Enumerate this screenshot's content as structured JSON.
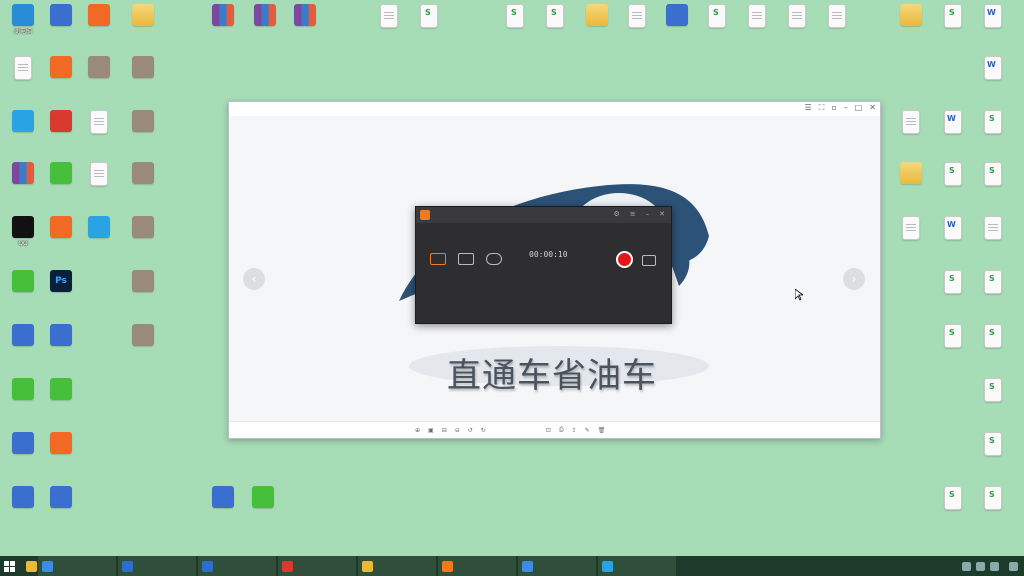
{
  "colors": {
    "desktop_bg": "#a6dcb6",
    "taskbar_bg": "#1e3a2a",
    "accent_orange": "#f07a1c",
    "record_red": "#e6141b"
  },
  "desktop": {
    "col1": [
      {
        "label": "此电脑",
        "icon": "monitor-icon",
        "kind": "monitor"
      },
      {
        "label": "",
        "icon": "document-icon",
        "kind": "doc"
      },
      {
        "label": "",
        "icon": "app-icon",
        "kind": "blue"
      },
      {
        "label": "",
        "icon": "winrar-icon",
        "kind": "winrar"
      },
      {
        "label": "QQ",
        "icon": "qq-penguin-icon",
        "kind": "penguin"
      },
      {
        "label": "",
        "icon": "app-icon",
        "kind": "green"
      },
      {
        "label": "",
        "icon": "app-icon",
        "kind": "app"
      },
      {
        "label": "",
        "icon": "app-icon",
        "kind": "green"
      },
      {
        "label": "",
        "icon": "app-icon",
        "kind": "app"
      },
      {
        "label": "",
        "icon": "network-icon",
        "kind": "app"
      }
    ],
    "col2": [
      {
        "label": "",
        "icon": "app-icon",
        "kind": "app"
      },
      {
        "label": "",
        "icon": "app-icon",
        "kind": "orange"
      },
      {
        "label": "",
        "icon": "app-icon",
        "kind": "red"
      },
      {
        "label": "",
        "icon": "app-icon",
        "kind": "green"
      },
      {
        "label": "",
        "icon": "app-icon",
        "kind": "orange"
      },
      {
        "label": "",
        "icon": "photoshop-icon",
        "kind": "ps",
        "glyph": "Ps"
      },
      {
        "label": "",
        "icon": "app-icon",
        "kind": "app"
      },
      {
        "label": "",
        "icon": "app-icon",
        "kind": "green"
      },
      {
        "label": "",
        "icon": "app-icon",
        "kind": "orange"
      },
      {
        "label": "",
        "icon": "network-icon",
        "kind": "app"
      }
    ],
    "col3": [
      {
        "label": "",
        "icon": "app-icon",
        "kind": "orange"
      },
      {
        "label": "",
        "icon": "exe-icon",
        "kind": "exe"
      },
      {
        "label": "",
        "icon": "document-icon",
        "kind": "doc"
      },
      {
        "label": "",
        "icon": "document-icon",
        "kind": "doc"
      },
      {
        "label": "",
        "icon": "app-icon",
        "kind": "blue"
      }
    ],
    "col4": [
      {
        "label": "",
        "icon": "folder-icon",
        "kind": "folder"
      },
      {
        "label": "",
        "icon": "exe-icon",
        "kind": "exe"
      },
      {
        "label": "",
        "icon": "exe-icon",
        "kind": "exe"
      },
      {
        "label": "",
        "icon": "exe-icon",
        "kind": "exe"
      },
      {
        "label": "",
        "icon": "exe-icon",
        "kind": "exe"
      },
      {
        "label": "",
        "icon": "exe-icon",
        "kind": "exe"
      },
      {
        "label": "",
        "icon": "exe-icon",
        "kind": "exe"
      }
    ],
    "top_row": [
      {
        "label": "",
        "icon": "winrar-icon",
        "kind": "winrar"
      },
      {
        "label": "",
        "icon": "winrar-icon",
        "kind": "winrar"
      },
      {
        "label": "",
        "icon": "winrar-icon",
        "kind": "winrar"
      },
      {
        "label": "",
        "icon": "document-icon",
        "kind": "doc"
      },
      {
        "label": "",
        "icon": "spreadsheet-icon",
        "kind": "xls"
      },
      {
        "label": "",
        "icon": "spreadsheet-icon",
        "kind": "xls"
      },
      {
        "label": "",
        "icon": "spreadsheet-icon",
        "kind": "xls"
      },
      {
        "label": "",
        "icon": "folder-icon",
        "kind": "folder"
      },
      {
        "label": "",
        "icon": "document-icon",
        "kind": "doc"
      },
      {
        "label": "",
        "icon": "app-icon",
        "kind": "app"
      },
      {
        "label": "",
        "icon": "spreadsheet-icon",
        "kind": "xls"
      },
      {
        "label": "",
        "icon": "document-icon",
        "kind": "doc"
      },
      {
        "label": "",
        "icon": "document-icon",
        "kind": "doc"
      },
      {
        "label": "",
        "icon": "document-icon",
        "kind": "doc"
      }
    ],
    "right_cols": [
      {
        "label": "",
        "icon": "folder-icon",
        "kind": "folder"
      },
      {
        "label": "",
        "icon": "spreadsheet-icon",
        "kind": "xls"
      },
      {
        "label": "",
        "icon": "word-icon",
        "kind": "word"
      },
      {
        "label": "",
        "icon": "word-icon",
        "kind": "word"
      },
      {
        "label": "",
        "icon": "document-icon",
        "kind": "doc"
      },
      {
        "label": "",
        "icon": "word-icon",
        "kind": "word"
      },
      {
        "label": "",
        "icon": "spreadsheet-icon",
        "kind": "xls"
      },
      {
        "label": "",
        "icon": "folder-icon",
        "kind": "folder"
      },
      {
        "label": "",
        "icon": "spreadsheet-icon",
        "kind": "xls"
      },
      {
        "label": "",
        "icon": "spreadsheet-icon",
        "kind": "xls"
      },
      {
        "label": "",
        "icon": "document-icon",
        "kind": "doc"
      },
      {
        "label": "",
        "icon": "word-icon",
        "kind": "word"
      },
      {
        "label": "",
        "icon": "document-icon",
        "kind": "doc"
      },
      {
        "label": "",
        "icon": "spreadsheet-icon",
        "kind": "xls"
      },
      {
        "label": "",
        "icon": "spreadsheet-icon",
        "kind": "xls"
      },
      {
        "label": "",
        "icon": "spreadsheet-icon",
        "kind": "xls"
      },
      {
        "label": "",
        "icon": "spreadsheet-icon",
        "kind": "xls"
      },
      {
        "label": "",
        "icon": "spreadsheet-icon",
        "kind": "xls"
      },
      {
        "label": "",
        "icon": "spreadsheet-icon",
        "kind": "xls"
      },
      {
        "label": "",
        "icon": "spreadsheet-icon",
        "kind": "xls"
      },
      {
        "label": "",
        "icon": "spreadsheet-icon",
        "kind": "xls"
      }
    ],
    "bottom_icons": [
      {
        "label": "",
        "icon": "app-icon",
        "kind": "app"
      },
      {
        "label": "",
        "icon": "app-icon",
        "kind": "green"
      }
    ]
  },
  "viewer": {
    "title": "",
    "version": "",
    "caption": "直通车省油车",
    "bottom_left": "",
    "bottom_right": "",
    "prev_arrow": "‹",
    "next_arrow": "›"
  },
  "recorder": {
    "app_name": "",
    "timer": "00:00:10",
    "settings_label": "",
    "audio_label": "",
    "record_button": "",
    "left_link": "",
    "right_link": ""
  },
  "taskbar": {
    "tasks": [
      {
        "label": "",
        "icon": "browser-icon",
        "color": "#3a8de0"
      },
      {
        "label": "",
        "icon": "app-icon",
        "color": "#2a6fc9"
      },
      {
        "label": "",
        "icon": "app-icon",
        "color": "#2a6fc9"
      },
      {
        "label": "",
        "icon": "app-icon",
        "color": "#d93a2f"
      },
      {
        "label": "",
        "icon": "folder-icon",
        "color": "#e9b93b"
      },
      {
        "label": "",
        "icon": "recorder-icon",
        "color": "#f07a1c"
      },
      {
        "label": "",
        "icon": "browser-icon",
        "color": "#3a8de0"
      },
      {
        "label": "",
        "icon": "viewer-icon",
        "color": "#2aa3e2"
      }
    ],
    "clock_time": "",
    "clock_date": ""
  }
}
